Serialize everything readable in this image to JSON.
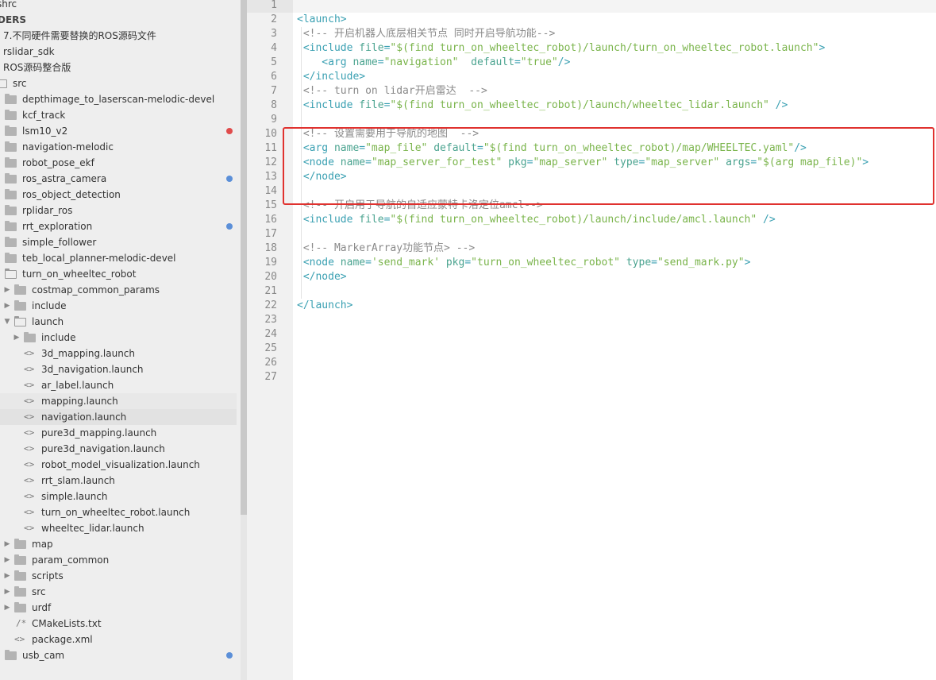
{
  "sidebar": {
    "rows": [
      {
        "label": "shrc",
        "indent": -4,
        "type": "text"
      },
      {
        "label": "DERS",
        "indent": -3,
        "type": "header"
      },
      {
        "label": "7.不同硬件需要替换的ROS源码文件",
        "indent": 4,
        "type": "text"
      },
      {
        "label": "rslidar_sdk",
        "indent": 4,
        "type": "text"
      },
      {
        "label": "ROS源码整合版",
        "indent": 4,
        "type": "text"
      },
      {
        "label": "src",
        "indent": 16,
        "type": "folder-open"
      },
      {
        "label": "depthimage_to_laserscan-melodic-devel",
        "indent": 28,
        "type": "folder"
      },
      {
        "label": "kcf_track",
        "indent": 28,
        "type": "folder"
      },
      {
        "label": "lsm10_v2",
        "indent": 28,
        "type": "folder",
        "dot": "red"
      },
      {
        "label": "navigation-melodic",
        "indent": 28,
        "type": "folder"
      },
      {
        "label": "robot_pose_ekf",
        "indent": 28,
        "type": "folder"
      },
      {
        "label": "ros_astra_camera",
        "indent": 28,
        "type": "folder",
        "dot": "blue"
      },
      {
        "label": "ros_object_detection",
        "indent": 28,
        "type": "folder"
      },
      {
        "label": "rplidar_ros",
        "indent": 28,
        "type": "folder"
      },
      {
        "label": "rrt_exploration",
        "indent": 28,
        "type": "folder",
        "dot": "blue"
      },
      {
        "label": "simple_follower",
        "indent": 28,
        "type": "folder"
      },
      {
        "label": "teb_local_planner-melodic-devel",
        "indent": 28,
        "type": "folder"
      },
      {
        "label": "turn_on_wheeltec_robot",
        "indent": 28,
        "type": "folder-open-partial"
      },
      {
        "label": "costmap_common_params",
        "indent": 40,
        "type": "folder",
        "arrow": "right"
      },
      {
        "label": "include",
        "indent": 40,
        "type": "folder",
        "arrow": "right"
      },
      {
        "label": "launch",
        "indent": 40,
        "type": "folder-open",
        "arrow": "down"
      },
      {
        "label": "include",
        "indent": 52,
        "type": "folder",
        "arrow": "right"
      },
      {
        "label": "3d_mapping.launch",
        "indent": 52,
        "type": "file"
      },
      {
        "label": "3d_navigation.launch",
        "indent": 52,
        "type": "file"
      },
      {
        "label": "ar_label.launch",
        "indent": 52,
        "type": "file"
      },
      {
        "label": "mapping.launch",
        "indent": 52,
        "type": "file",
        "state": "hover"
      },
      {
        "label": "navigation.launch",
        "indent": 52,
        "type": "file",
        "state": "selected"
      },
      {
        "label": "pure3d_mapping.launch",
        "indent": 52,
        "type": "file"
      },
      {
        "label": "pure3d_navigation.launch",
        "indent": 52,
        "type": "file"
      },
      {
        "label": "robot_model_visualization.launch",
        "indent": 52,
        "type": "file"
      },
      {
        "label": "rrt_slam.launch",
        "indent": 52,
        "type": "file"
      },
      {
        "label": "simple.launch",
        "indent": 52,
        "type": "file"
      },
      {
        "label": "turn_on_wheeltec_robot.launch",
        "indent": 52,
        "type": "file"
      },
      {
        "label": "wheeltec_lidar.launch",
        "indent": 52,
        "type": "file"
      },
      {
        "label": "map",
        "indent": 40,
        "type": "folder",
        "arrow": "right"
      },
      {
        "label": "param_common",
        "indent": 40,
        "type": "folder",
        "arrow": "right"
      },
      {
        "label": "scripts",
        "indent": 40,
        "type": "folder",
        "arrow": "right"
      },
      {
        "label": "src",
        "indent": 40,
        "type": "folder",
        "arrow": "right"
      },
      {
        "label": "urdf",
        "indent": 40,
        "type": "folder",
        "arrow": "right"
      },
      {
        "label": "CMakeLists.txt",
        "indent": 40,
        "type": "cfile"
      },
      {
        "label": "package.xml",
        "indent": 40,
        "type": "file"
      },
      {
        "label": "usb_cam",
        "indent": 28,
        "type": "folder",
        "dot": "blue"
      }
    ]
  },
  "editor": {
    "line_numbers": [
      "1",
      "2",
      "3",
      "4",
      "5",
      "6",
      "7",
      "8",
      "9",
      "10",
      "11",
      "12",
      "13",
      "14",
      "15",
      "16",
      "17",
      "18",
      "19",
      "20",
      "21",
      "22",
      "23",
      "24",
      "25",
      "26",
      "27"
    ],
    "lines": [
      [],
      [
        [
          "tg",
          "<launch>"
        ]
      ],
      [
        [
          "cm",
          " <!-- 开启机器人底层相关节点 同时开启导航功能-->"
        ]
      ],
      [
        [
          "tg",
          " <include "
        ],
        [
          "at",
          "file"
        ],
        [
          "tg",
          "="
        ],
        [
          "st",
          "\"$(find turn_on_wheeltec_robot)/launch/turn_on_wheeltec_robot.launch\""
        ],
        [
          "tg",
          ">"
        ]
      ],
      [
        [
          "tg",
          "    <arg "
        ],
        [
          "at",
          "name"
        ],
        [
          "tg",
          "="
        ],
        [
          "st",
          "\"navigation\""
        ],
        [
          "at",
          "  default"
        ],
        [
          "tg",
          "="
        ],
        [
          "st",
          "\"true\""
        ],
        [
          "tg",
          "/>"
        ]
      ],
      [
        [
          "tg",
          " </include>"
        ]
      ],
      [
        [
          "cm",
          " <!-- turn on lidar开启雷达  -->"
        ]
      ],
      [
        [
          "tg",
          " <include "
        ],
        [
          "at",
          "file"
        ],
        [
          "tg",
          "="
        ],
        [
          "st",
          "\"$(find turn_on_wheeltec_robot)/launch/wheeltec_lidar.launch\""
        ],
        [
          "tg",
          " />"
        ]
      ],
      [],
      [
        [
          "cm",
          " <!-- 设置需要用于导航的地图  -->"
        ]
      ],
      [
        [
          "tg",
          " <arg "
        ],
        [
          "at",
          "name"
        ],
        [
          "tg",
          "="
        ],
        [
          "st",
          "\"map_file\""
        ],
        [
          "at",
          " default"
        ],
        [
          "tg",
          "="
        ],
        [
          "st",
          "\"$(find turn_on_wheeltec_robot)/map/WHEELTEC.yaml\""
        ],
        [
          "tg",
          "/>"
        ]
      ],
      [
        [
          "tg",
          " <node "
        ],
        [
          "at",
          "name"
        ],
        [
          "tg",
          "="
        ],
        [
          "st",
          "\"map_server_for_test\""
        ],
        [
          "at",
          " pkg"
        ],
        [
          "tg",
          "="
        ],
        [
          "st",
          "\"map_server\""
        ],
        [
          "at",
          " type"
        ],
        [
          "tg",
          "="
        ],
        [
          "st",
          "\"map_server\""
        ],
        [
          "at",
          " args"
        ],
        [
          "tg",
          "="
        ],
        [
          "st",
          "\"$(arg map_file)\""
        ],
        [
          "tg",
          ">"
        ]
      ],
      [
        [
          "tg",
          " </node>"
        ]
      ],
      [],
      [
        [
          "cm",
          " <!-- 开启用于导航的自适应蒙特卡洛定位amcl-->"
        ]
      ],
      [
        [
          "tg",
          " <include "
        ],
        [
          "at",
          "file"
        ],
        [
          "tg",
          "="
        ],
        [
          "st",
          "\"$(find turn_on_wheeltec_robot)/launch/include/amcl.launch\""
        ],
        [
          "tg",
          " />"
        ]
      ],
      [],
      [
        [
          "cm",
          " <!-- MarkerArray功能节点> -->"
        ]
      ],
      [
        [
          "tg",
          " <node "
        ],
        [
          "at",
          "name"
        ],
        [
          "tg",
          "="
        ],
        [
          "st",
          "'send_mark'"
        ],
        [
          "at",
          " pkg"
        ],
        [
          "tg",
          "="
        ],
        [
          "st",
          "\"turn_on_wheeltec_robot\""
        ],
        [
          "at",
          " type"
        ],
        [
          "tg",
          "="
        ],
        [
          "st",
          "\"send_mark.py\""
        ],
        [
          "tg",
          ">"
        ]
      ],
      [
        [
          "tg",
          " </node>"
        ]
      ],
      [],
      [
        [
          "tg",
          "</launch>"
        ]
      ],
      [],
      [],
      [],
      [],
      []
    ]
  }
}
